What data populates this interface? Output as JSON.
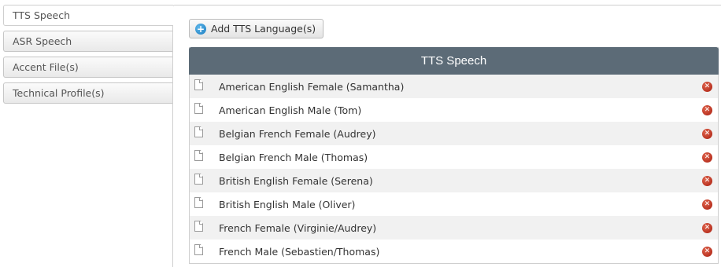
{
  "tabs": [
    {
      "label": "TTS Speech",
      "active": true
    },
    {
      "label": "ASR Speech",
      "active": false
    },
    {
      "label": "Accent File(s)",
      "active": false
    },
    {
      "label": "Technical Profile(s)",
      "active": false
    }
  ],
  "toolbar": {
    "add_label": "Add TTS Language(s)",
    "add_icon": "plus-circle-icon"
  },
  "grid": {
    "title": "TTS Speech",
    "header_color": "#5c6b77",
    "rows": [
      {
        "label": "American English Female (Samantha)"
      },
      {
        "label": "American English Male (Tom)"
      },
      {
        "label": "Belgian French Female (Audrey)"
      },
      {
        "label": "Belgian French Male (Thomas)"
      },
      {
        "label": "British English Female (Serena)"
      },
      {
        "label": "British English Male (Oliver)"
      },
      {
        "label": "French Female (Virginie/Audrey)"
      },
      {
        "label": "French Male (Sebastien/Thomas)"
      }
    ],
    "row_icon": "document-icon",
    "delete_icon": "delete-icon",
    "delete_color": "#c0301c"
  }
}
